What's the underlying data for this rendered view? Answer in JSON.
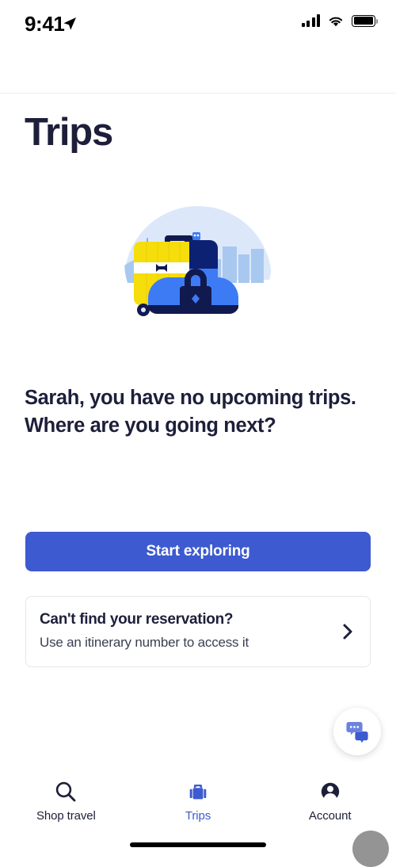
{
  "status_bar": {
    "time": "9:41",
    "location_icon": "location-arrow-icon",
    "signal_icon": "cellular-signal-icon",
    "wifi_icon": "wifi-icon",
    "battery_icon": "battery-full-icon"
  },
  "header": {
    "title": "Trips"
  },
  "illustration": {
    "name": "luggage-illustration",
    "colors": {
      "backdrop": "#dce8fa",
      "skyline": "#a8c8f0",
      "suitcase_yellow": "#f6dd0c",
      "suitcase_navy": "#0d2173",
      "duffel_blue": "#3d7bf5",
      "dark_navy": "#111a4f"
    }
  },
  "empty_state": {
    "message": "Sarah, you have no upcoming trips. Where are you going next?",
    "cta_label": "Start exploring"
  },
  "reservation_card": {
    "title": "Can't find your reservation?",
    "subtitle": "Use an itinerary number to access it",
    "chevron_icon": "chevron-right-icon"
  },
  "chat_fab": {
    "icon": "chat-bubbles-icon",
    "bubble_light": "#7b8ce8",
    "bubble_dark": "#3d5ad0"
  },
  "bottom_nav": {
    "items": [
      {
        "label": "Shop travel",
        "icon": "search-icon",
        "active": false
      },
      {
        "label": "Trips",
        "icon": "suitcase-icon",
        "active": true
      },
      {
        "label": "Account",
        "icon": "account-person-icon",
        "active": false
      }
    ]
  },
  "colors": {
    "accent_blue": "#3d5ad0",
    "text_dark": "#1d1f3a",
    "border": "#e4e6ea"
  }
}
